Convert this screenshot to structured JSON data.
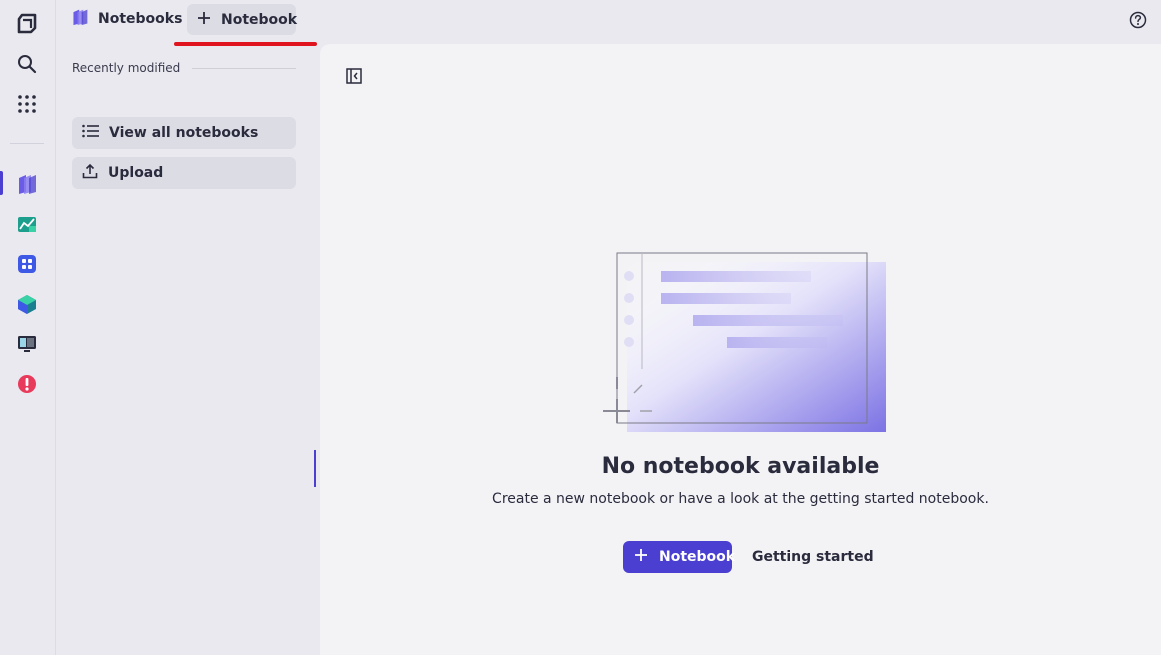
{
  "rail": {
    "items": [
      {
        "icon": "dynatrace-logo-icon"
      },
      {
        "icon": "search-icon"
      },
      {
        "icon": "apps-grid-icon"
      },
      {
        "icon": "notebooks-app-icon"
      },
      {
        "icon": "dashboards-app-icon"
      },
      {
        "icon": "workflows-app-icon"
      },
      {
        "icon": "infrastructure-app-icon"
      },
      {
        "icon": "monitor-app-icon"
      },
      {
        "icon": "problems-app-icon"
      }
    ]
  },
  "header": {
    "app_title": "Notebooks",
    "new_tab_label": "Notebook",
    "help_icon": "help-icon"
  },
  "sidebar": {
    "section_title": "Recently modified",
    "view_all_label": "View all notebooks",
    "upload_label": "Upload"
  },
  "main": {
    "empty_title": "No notebook available",
    "empty_subtitle": "Create a new notebook or have a look at the getting started notebook.",
    "primary_button_label": "Notebook",
    "secondary_button_label": "Getting started"
  },
  "colors": {
    "accent": "#4a3fd0",
    "tab_indicator": "#e0141e",
    "background": "#e9e9ef",
    "main_background": "#f3f3f6"
  }
}
